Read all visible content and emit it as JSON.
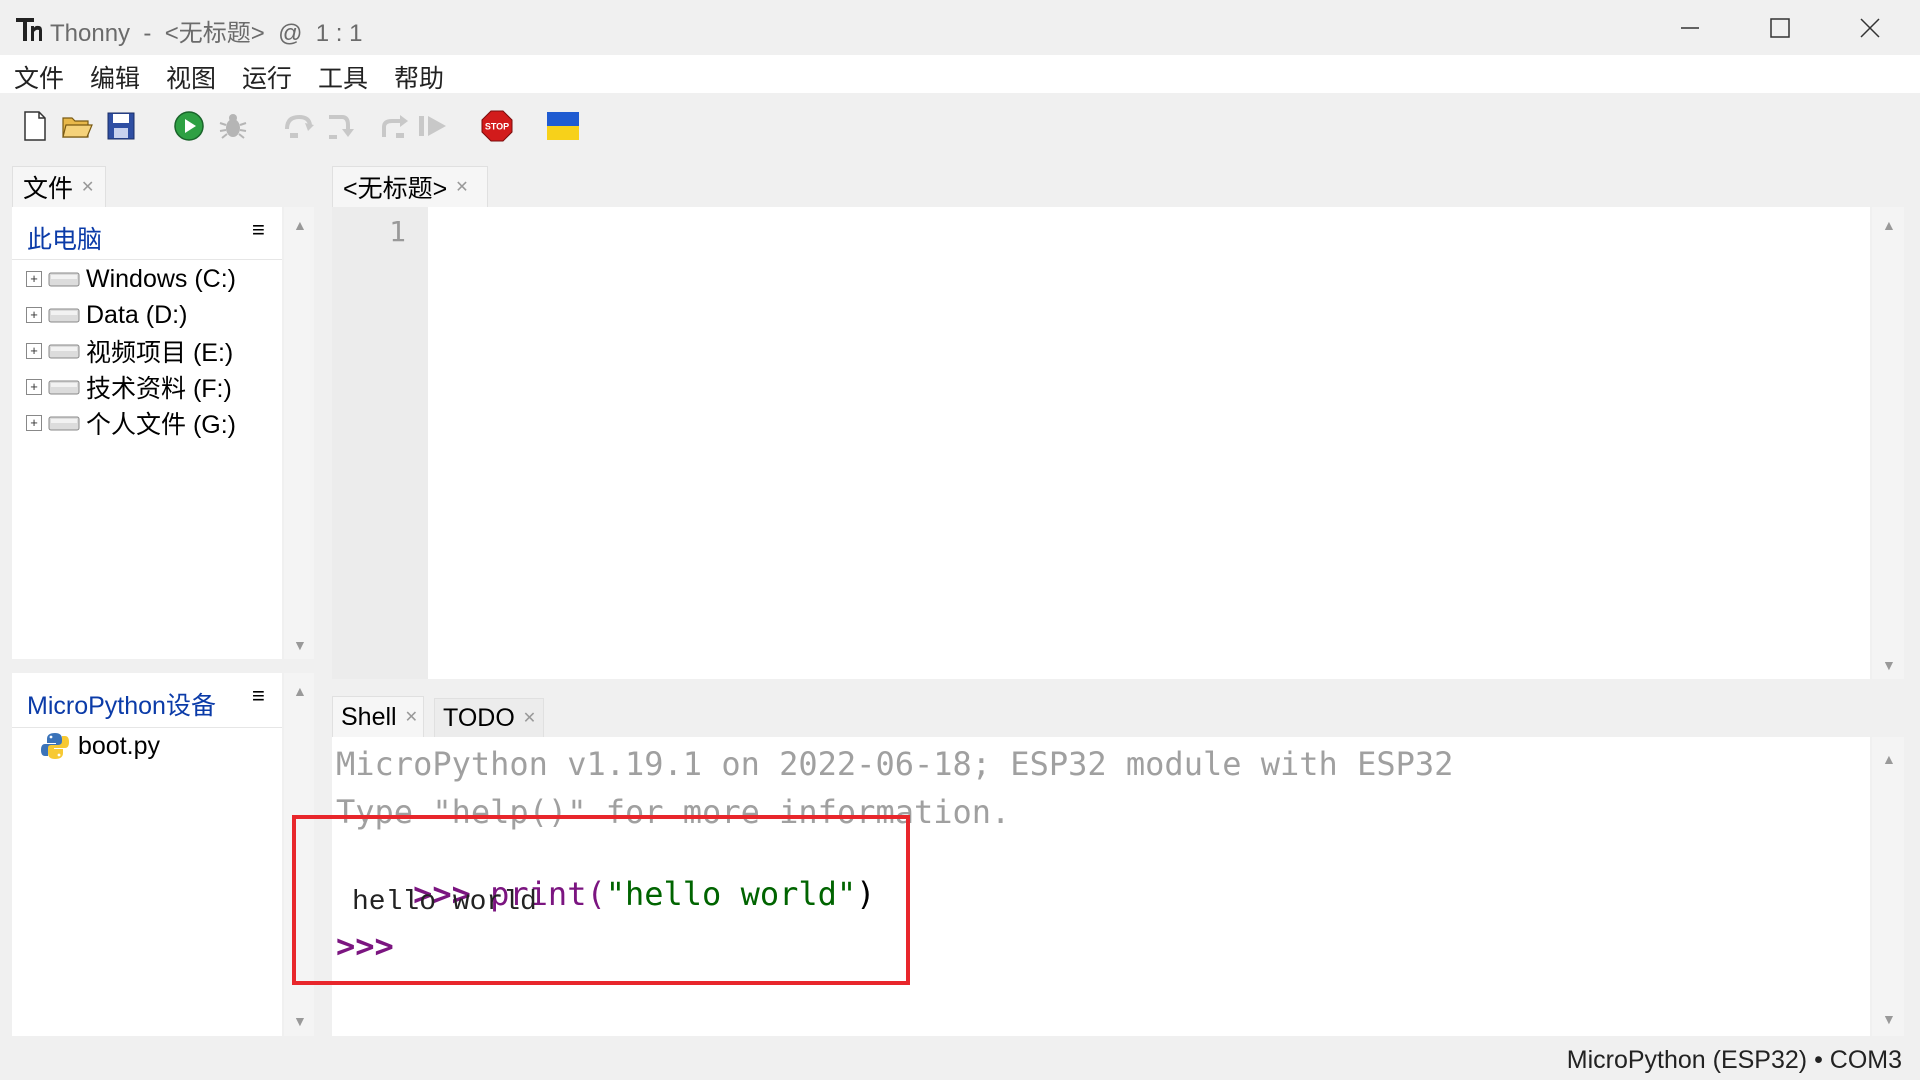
{
  "window": {
    "title": "Thonny  -  <无标题>  @  1 : 1"
  },
  "menu": [
    "文件",
    "编辑",
    "视图",
    "运行",
    "工具",
    "帮助"
  ],
  "toolbar": {
    "stop_label": "STOP"
  },
  "files_panel": {
    "tab_label": "文件",
    "computer_header": "此电脑",
    "drives": [
      "Windows (C:)",
      "Data (D:)",
      "视频项目 (E:)",
      "技术资料 (F:)",
      "个人文件 (G:)"
    ],
    "device_header": "MicroPython设备",
    "device_files": [
      "boot.py"
    ]
  },
  "editor": {
    "tab_label": "<无标题>",
    "line_number": "1"
  },
  "shell": {
    "tabs": [
      "Shell",
      "TODO"
    ],
    "banner_line1": "MicroPython v1.19.1 on 2022-06-18; ESP32 module with ESP32",
    "banner_line2": "Type \"help()\" for more information.",
    "prompt": ">>>",
    "command_func": "print(",
    "command_string": "\"hello world\"",
    "command_close": ")",
    "output": "hello world"
  },
  "status_bar": {
    "interpreter": "MicroPython (ESP32) • COM3"
  },
  "colors": {
    "prompt": "#7b1580",
    "string": "#006400",
    "banner": "#a0a0a0",
    "link": "#0b3ba8",
    "highlight_box": "#e8262b"
  }
}
